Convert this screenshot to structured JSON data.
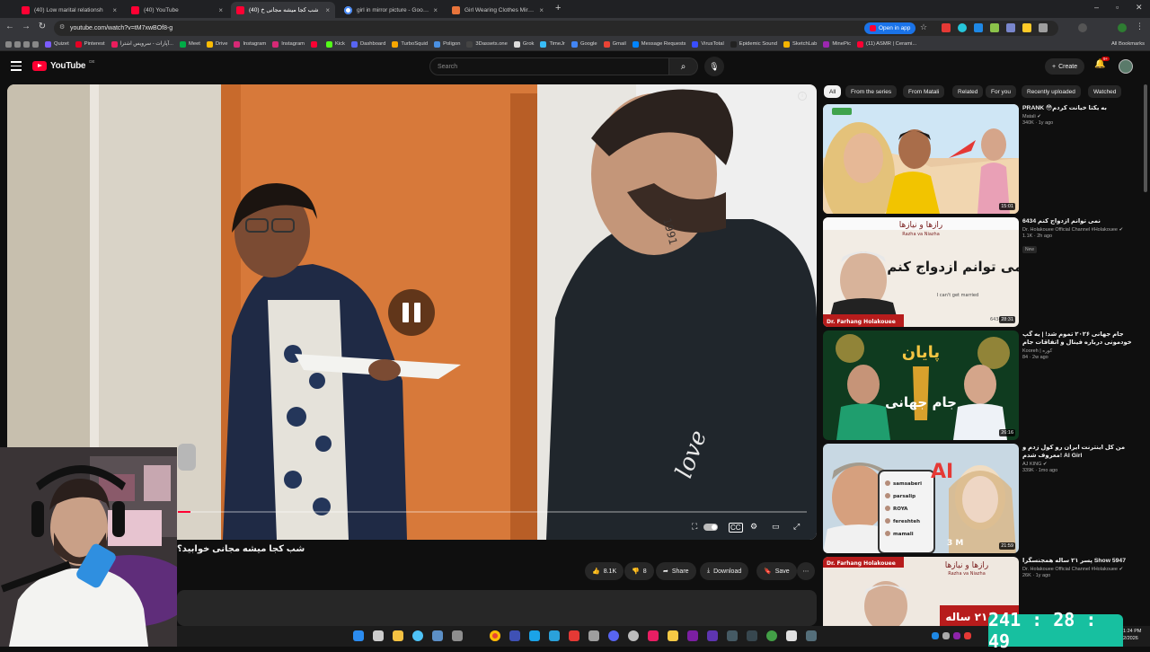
{
  "browser": {
    "tabs": [
      {
        "title": "(40) Low marital relationsh",
        "fav": "yt",
        "active": false
      },
      {
        "title": "(40) YouTube",
        "fav": "yt",
        "active": false
      },
      {
        "title": "(40) شب کجا میشه مجانی خ",
        "fav": "yt",
        "active": true
      },
      {
        "title": "girl in mirror picture - Google",
        "fav": "g",
        "active": false
      },
      {
        "title": "Girl Wearing Clothes Mirror Sel",
        "fav": "o",
        "active": false
      }
    ],
    "new_tab_label": "+",
    "url": "youtube.com/watch?v=tM7xwBOf8-g",
    "open_in_app": "Open in app",
    "all_bookmarks": "All Bookmarks",
    "bookmarks": [
      {
        "label": "Quizet",
        "color": "#7b5cff"
      },
      {
        "label": "Pinterest",
        "color": "#e60023"
      },
      {
        "label": "آپارات - سرویس اشترا...",
        "color": "#ea1d5d"
      },
      {
        "label": "Meet",
        "color": "#00ac47"
      },
      {
        "label": "Drive",
        "color": "#fbbc04"
      },
      {
        "label": "Instagram",
        "color": "#d62976"
      },
      {
        "label": "Instagram",
        "color": "#d62976"
      },
      {
        "label": "",
        "color": "#ff0033"
      },
      {
        "label": "Kick",
        "color": "#53fc18"
      },
      {
        "label": "Dashboard",
        "color": "#5865f2"
      },
      {
        "label": "TurboSquid",
        "color": "#f7a600"
      },
      {
        "label": "Poligon",
        "color": "#4a90e2"
      },
      {
        "label": "3Dassets.one",
        "color": "#444"
      },
      {
        "label": "Grok",
        "color": "#ddd"
      },
      {
        "label": "TimeJr",
        "color": "#38bdf8"
      },
      {
        "label": "Google",
        "color": "#4285f4"
      },
      {
        "label": "Gmail",
        "color": "#ea4335"
      },
      {
        "label": "Message Requests",
        "color": "#0084ff"
      },
      {
        "label": "VirusTotal",
        "color": "#394eff"
      },
      {
        "label": "Epidemic Sound",
        "color": "#222"
      },
      {
        "label": "SketchLab",
        "color": "#f4b400"
      },
      {
        "label": "MinePic",
        "color": "#9c27b0"
      },
      {
        "label": "(11) ASMR | Cerami...",
        "color": "#ff0033"
      }
    ]
  },
  "youtube": {
    "logo_text": "YouTube",
    "country_code": "DE",
    "search_placeholder": "Search",
    "create_label": "Create",
    "notif_count": "9+"
  },
  "player": {
    "progress_fraction": 0.02
  },
  "video": {
    "title": "شب کجا میشه مجانی خوابید؟",
    "likes": "8.1K",
    "dislikes": "8",
    "share": "Share",
    "download": "Download",
    "save": "Save"
  },
  "chips": [
    "All",
    "From the series",
    "From Matali",
    "Related",
    "For you",
    "Recently uploaded",
    "Watched"
  ],
  "recommendations": [
    {
      "title": "PRANK 😳به یکتا خیانت کردم",
      "channel": "Matali ✔",
      "stats": "340K · 1y ago",
      "duration": "15:01",
      "badge": ""
    },
    {
      "title": "6434 نمی توانم ازدواج کنم",
      "channel": "Dr. Holakouee Official Channel #Holakouee ✔",
      "stats": "1.1K · 2h ago",
      "duration": "28:31",
      "badge": "New"
    },
    {
      "title": "جام جهانی ۲۰۲۶ تموم شد! | یه گپ خودمونی درباره فینال و اتفاقات جام",
      "channel": "Kooreh | کوره",
      "stats": "84 · 2w ago",
      "duration": "26:16",
      "badge": ""
    },
    {
      "title": "من کل اینترنت ایران رو کول زدم و معروف شدم! AI Girl",
      "channel": "AJ KING ✔",
      "stats": "339K · 1mo ago",
      "duration": "21:59",
      "badge": ""
    },
    {
      "title": "پسر ۲۱ ساله همجنسگرا Show 5947",
      "channel": "Dr. Holakouee Official Channel #Holakouee ✔",
      "stats": "26K · 1y ago",
      "duration": "",
      "badge": ""
    }
  ],
  "thumb_text": {
    "t2_header": "رازها و نیازها",
    "t2_header_en": "Razha va Niazha",
    "t2_main": "نمی توانم ازدواج کنم",
    "t2_sub": "I can't get married",
    "t2_name": "Dr. Farhang Holakouee",
    "t2_num": "6434",
    "t3_top": "پایان",
    "t3_main": "جام جهانی",
    "t4_badge": "AI",
    "t4_stat": "3 M",
    "t4_list": [
      "samsaberi",
      "parsalip",
      "ROYA",
      "fereshteh",
      "mamali"
    ],
    "t5_name": "Dr. Farhang Holakouee",
    "t5_header": "رازها و نیازها",
    "t5_header_en": "Razha va Niazha",
    "t5_bottom": "پسر ۲۱ ساله"
  },
  "scene_text": {
    "neck_tattoo": "1991",
    "hoodie_print": "love"
  },
  "timer": "241 : 28 : 49",
  "clock": {
    "time": "1:24 PM",
    "date": "2/2026"
  }
}
